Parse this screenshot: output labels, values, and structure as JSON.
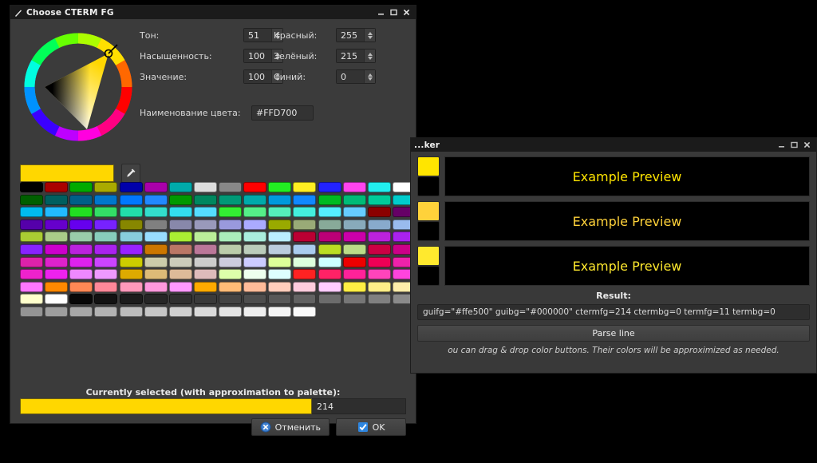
{
  "dialog": {
    "title": "Choose CTERM FG",
    "titlebar_icon": "pencil-icon",
    "buttons": {
      "minimize": "_",
      "maximize": "□",
      "close": "×"
    },
    "hsv": [
      {
        "label": "Тон:",
        "value": "51"
      },
      {
        "label": "Насыщенность:",
        "value": "100"
      },
      {
        "label": "Значение:",
        "value": "100"
      }
    ],
    "rgb": [
      {
        "label": "Красный:",
        "value": "255"
      },
      {
        "label": "Зелёный:",
        "value": "215"
      },
      {
        "label": "Синий:",
        "value": "0"
      }
    ],
    "color_name": {
      "label": "Наименование цвета:",
      "value": "#FFD700"
    },
    "current_color": "#FFD700",
    "pipette_icon": "eyedropper-icon",
    "currently_selected_label": "Currently selected (with approximation to palette):",
    "currently_selected_color": "#FFD700",
    "currently_selected_index": "214",
    "cancel_label": "Отменить",
    "ok_label": "OK",
    "selected_swatch_index": 214,
    "palette": [
      "#000000",
      "#aa0000",
      "#00aa00",
      "#aaaa00",
      "#0000aa",
      "#aa00aa",
      "#00aaaa",
      "#dddddd",
      "#888888",
      "#ff0000",
      "#22ee22",
      "#ffee22",
      "#2222ff",
      "#ff44ee",
      "#22eeee",
      "#ffffff",
      "#005f00",
      "#005f5f",
      "#005f87",
      "#0077cc",
      "#0077ff",
      "#2288ff",
      "#009900",
      "#00875f",
      "#009977",
      "#00aaaa",
      "#0099dd",
      "#1188ff",
      "#00bb22",
      "#00bb77",
      "#00cc99",
      "#00cccc",
      "#00bbee",
      "#22bbff",
      "#22dd22",
      "#33dd66",
      "#22ddaa",
      "#33ddcc",
      "#33ddee",
      "#55ddff",
      "#33ee33",
      "#55ee88",
      "#55eebb",
      "#44eedd",
      "#55eeff",
      "#66ccff",
      "#8b0000",
      "#660066",
      "#5500aa",
      "#6600cc",
      "#6600ee",
      "#7722ff",
      "#878700",
      "#808080",
      "#8888aa",
      "#9999bb",
      "#9999dd",
      "#aaaaff",
      "#99aa00",
      "#99aa77",
      "#88aa99",
      "#88aabb",
      "#88aacc",
      "#99bbee",
      "#aacc33",
      "#aacc88",
      "#99ccaa",
      "#88ccbb",
      "#88ccdd",
      "#99ddff",
      "#aaee33",
      "#bbee99",
      "#aaeebb",
      "#aaeedd",
      "#bbeeff",
      "#bb0033",
      "#bb0077",
      "#cc00aa",
      "#bb22dd",
      "#aa22ee",
      "#8822ff",
      "#cc00cc",
      "#bb22dd",
      "#aa22ee",
      "#9922ff",
      "#cc7700",
      "#bb7766",
      "#bb7799",
      "#bbccaa",
      "#bbccbb",
      "#bbccdd",
      "#aaccee",
      "#bbdd22",
      "#bbdd88",
      "#cc0044",
      "#cc0088",
      "#dd22aa",
      "#dd22cc",
      "#dd22ee",
      "#cc44ff",
      "#cccc00",
      "#ccccaa",
      "#ccccbb",
      "#cccccc",
      "#ccccdd",
      "#ccccff",
      "#ddff99",
      "#ddffdd",
      "#ccffff",
      "#ee0000",
      "#ee0055",
      "#ee22aa",
      "#ee22cc",
      "#ee22ee",
      "#ee88ff",
      "#ee99ff",
      "#ddaa00",
      "#ddbb77",
      "#ddbb99",
      "#ddbbbb",
      "#ddffaa",
      "#eeffee",
      "#ddffff",
      "#ff2222",
      "#ff2266",
      "#ff2299",
      "#ff44bb",
      "#ff44dd",
      "#ff77ff",
      "#ff8800",
      "#ff8855",
      "#ff8899",
      "#ff99bb",
      "#ff99dd",
      "#ff99ff",
      "#ffaa00",
      "#ffbb77",
      "#ffbb99",
      "#ffccbb",
      "#ffccdd",
      "#ffccff",
      "#ffee44",
      "#ffee88",
      "#ffeeaa",
      "#ffffcc",
      "#ffffff",
      "#080808",
      "#121212",
      "#1c1c1c",
      "#262626",
      "#303030",
      "#3a3a3a",
      "#444444",
      "#4e4e4e",
      "#585858",
      "#626262",
      "#6c6c6c",
      "#767676",
      "#808080",
      "#8a8a8a",
      "#949494",
      "#9e9e9e",
      "#a8a8a8",
      "#b2b2b2",
      "#bcbcbc",
      "#c6c6c6",
      "#d0d0d0",
      "#dadada",
      "#e4e4e4",
      "#eeeeee",
      "#f4f4f4",
      "#fafafa"
    ]
  },
  "picker": {
    "title": "...ker",
    "buttons": {
      "minimize": "_",
      "maximize": "□",
      "close": "×"
    },
    "previews": [
      {
        "fg": "#ffe500",
        "bg": "#000000",
        "text": "Example Preview"
      },
      {
        "fg": "#ffd23a",
        "bg": "#000000",
        "text": "Example Preview"
      },
      {
        "fg": "#ffe92e",
        "bg": "#000000",
        "text": "Example Preview"
      }
    ],
    "result_label": "Result:",
    "result_value": "guifg=\"#ffe500\" guibg=\"#000000\" ctermfg=214 ctermbg=0 termfg=11 termbg=0",
    "parse_label": "Parse line",
    "hint": "ou can drag & drop color buttons. Their colors will be approximized as needed."
  }
}
